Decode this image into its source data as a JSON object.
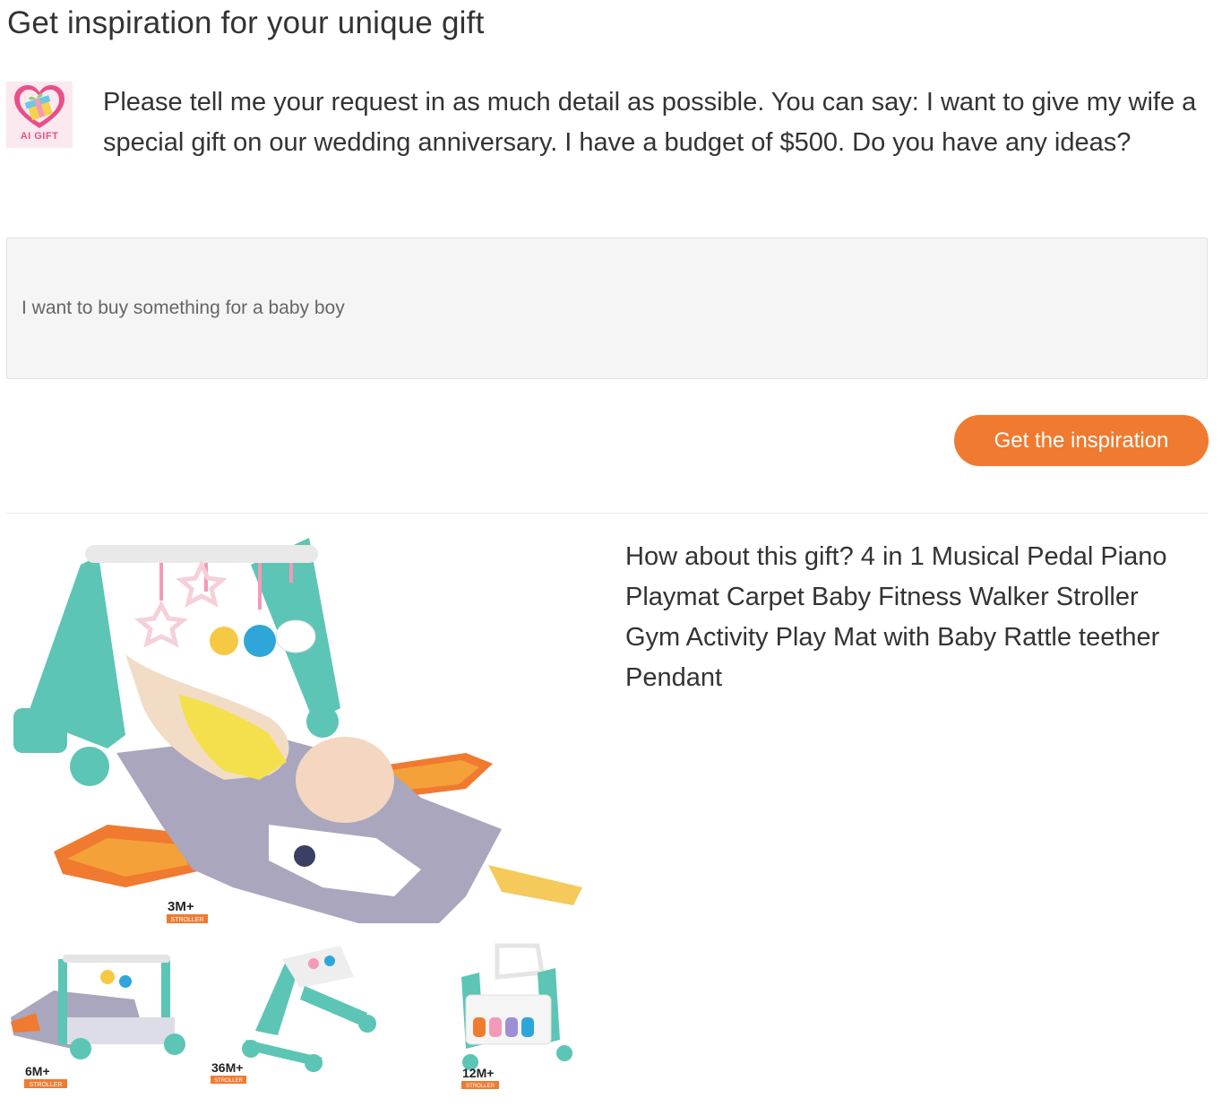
{
  "header": {
    "title": "Get inspiration for your unique gift"
  },
  "assistant": {
    "avatar_label": "AI GIFT",
    "avatar_icon": "gift-heart-icon",
    "prompt": "Please tell me your request in as much detail as possible. You can say: I want to give my wife a special gift on our wedding anniversary. I have a budget of $500. Do you have any ideas?"
  },
  "request_input": {
    "value": "I want to buy something for a baby boy"
  },
  "action": {
    "button_label": "Get the inspiration"
  },
  "result": {
    "text": "How about this gift? 4 in 1 Musical Pedal Piano Playmat Carpet Baby Fitness Walker Stroller Gym Activity Play Mat with Baby Rattle teether Pendant",
    "image_labels": {
      "main_age": "3M+",
      "main_tag": "STROLLER",
      "thumb1_age": "6M+",
      "thumb1_tag": "STROLLER",
      "thumb2_age": "36M+",
      "thumb2_tag": "STROLLER",
      "thumb3_age": "12M+",
      "thumb3_tag": "STROLLER"
    }
  },
  "colors": {
    "accent": "#f07a2f",
    "avatar_bg": "#fbe9ef",
    "input_bg": "#f5f5f5"
  }
}
